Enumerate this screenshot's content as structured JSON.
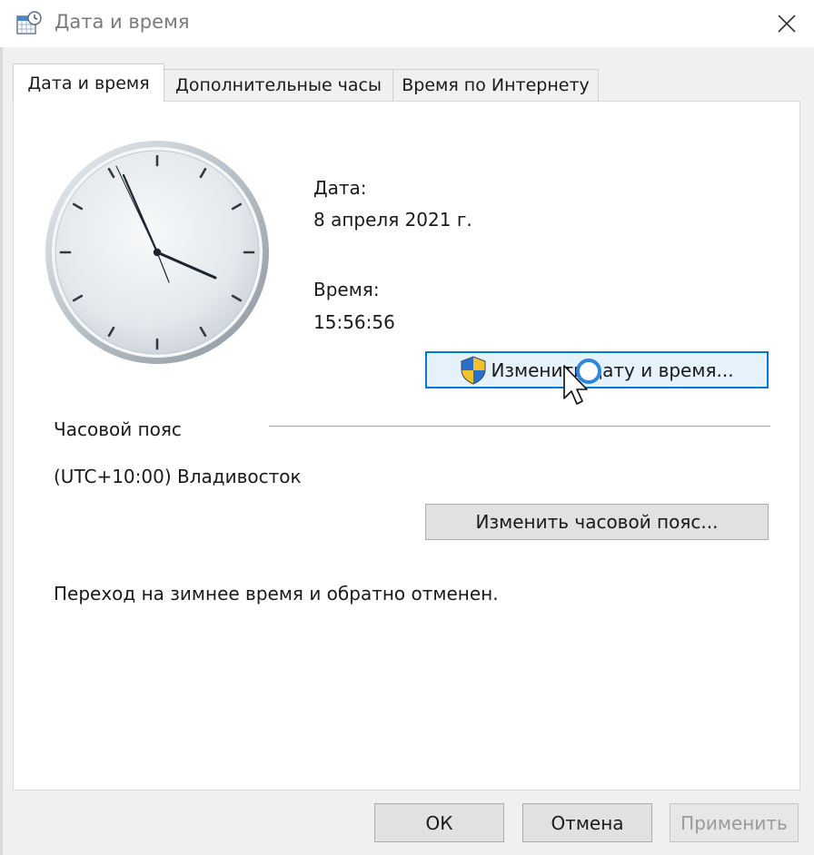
{
  "window": {
    "title": "Дата и время",
    "icon": "calendar-clock-icon"
  },
  "tabs": [
    {
      "label": "Дата и время",
      "active": true
    },
    {
      "label": "Дополнительные часы",
      "active": false
    },
    {
      "label": "Время по Интернету",
      "active": false
    }
  ],
  "date": {
    "label": "Дата:",
    "value": "8 апреля 2021 г."
  },
  "time": {
    "label": "Время:",
    "value": "15:56:56"
  },
  "change_datetime_button": {
    "label": "Изменить дату и время...",
    "icon": "uac-shield-icon"
  },
  "timezone": {
    "section_label": "Часовой пояс",
    "value": "(UTC+10:00) Владивосток",
    "change_button": "Изменить часовой пояс..."
  },
  "dst_note": "Переход на зимнее время и обратно отменен.",
  "footer": {
    "ok": "ОК",
    "cancel": "Отмена",
    "apply": "Применить"
  },
  "colors": {
    "focus_border": "#0078d7",
    "focus_fill": "#e5f1fb",
    "shield_blue": "#2a6fc9",
    "shield_yellow": "#f2c12e"
  }
}
